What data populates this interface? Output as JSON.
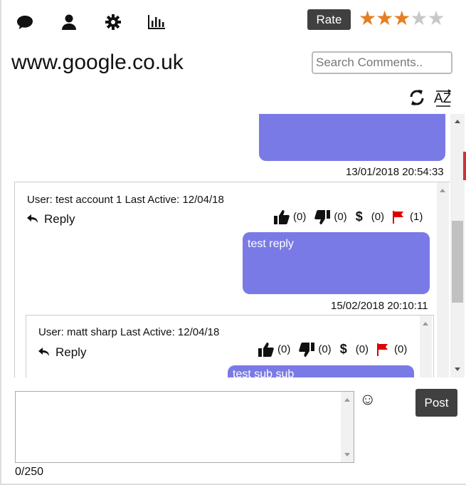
{
  "toolbar": {
    "icons": [
      "comments-icon",
      "user-icon",
      "settings-icon",
      "stats-icon"
    ],
    "rate_label": "Rate",
    "rating": {
      "value": 3,
      "max": 5
    },
    "star_filled_color": "#e67e22",
    "star_empty_color": "#c8c8c8",
    "star_glyph": "★"
  },
  "site": {
    "title": "www.google.co.uk"
  },
  "search": {
    "placeholder": "Search Comments.."
  },
  "sort": {
    "az_label": "AZ"
  },
  "feed": {
    "top_timestamp": "13/01/2018 20:54:33",
    "comments": [
      {
        "user_line": "User: test account 1 Last Active: 12/04/18",
        "reply_label": "Reply",
        "likes": "(0)",
        "dislikes": "(0)",
        "tips": "(0)",
        "flags": "(1)",
        "text": "test reply",
        "timestamp": "15/02/2018 20:10:11"
      },
      {
        "user_line": "User: matt sharp Last Active: 12/04/18",
        "reply_label": "Reply",
        "likes": "(0)",
        "dislikes": "(0)",
        "tips": "(0)",
        "flags": "(0)",
        "text": "test sub sub"
      }
    ]
  },
  "compose": {
    "value": "",
    "emoji": "☺",
    "post_label": "Post",
    "counter": "0/250"
  },
  "colors": {
    "bubble": "#7a7ae6",
    "dark_button": "#404040",
    "flag": "#e00000"
  }
}
